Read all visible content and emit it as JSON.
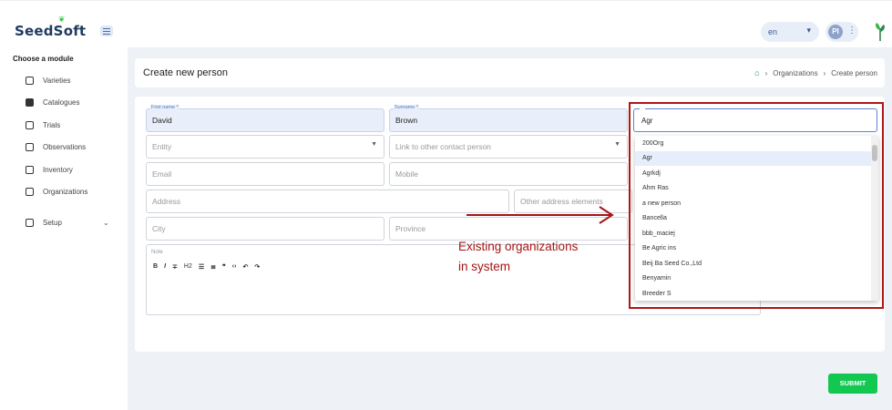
{
  "brand": {
    "name": "SeedSoft"
  },
  "header": {
    "lang": "en",
    "user_initials": "PI"
  },
  "sidebar": {
    "title": "Choose a module",
    "items": [
      {
        "label": "Varieties",
        "icon": "varieties-icon"
      },
      {
        "label": "Catalogues",
        "icon": "catalogues-icon"
      },
      {
        "label": "Trials",
        "icon": "trials-icon"
      },
      {
        "label": "Observations",
        "icon": "observations-icon"
      },
      {
        "label": "Inventory",
        "icon": "inventory-icon"
      },
      {
        "label": "Organizations",
        "icon": "organizations-icon"
      },
      {
        "label": "Setup",
        "icon": "setup-icon"
      }
    ]
  },
  "page": {
    "title": "Create new person",
    "breadcrumb": {
      "organizations": "Organizations",
      "current": "Create person"
    }
  },
  "form": {
    "first_name": {
      "label": "First name *",
      "value": "David"
    },
    "surname": {
      "label": "Surname *",
      "value": "Brown"
    },
    "entity": {
      "placeholder": "Entity"
    },
    "link_contact": {
      "placeholder": "Link to other contact person"
    },
    "email": {
      "placeholder": "Email"
    },
    "mobile": {
      "placeholder": "Mobile"
    },
    "address": {
      "placeholder": "Address"
    },
    "other_address": {
      "placeholder": "Other address elements"
    },
    "city": {
      "placeholder": "City"
    },
    "province": {
      "placeholder": "Province"
    },
    "note": {
      "label": "Note",
      "toolbar": [
        "B",
        "I",
        "S",
        "H2",
        "UL",
        "OL",
        "Quote",
        "Code",
        "Undo",
        "Redo"
      ]
    },
    "submit_label": "SUBMIT"
  },
  "supplier": {
    "value": "Agr",
    "options": [
      "200Org",
      "Agr",
      "Agrkdj",
      "Ahm Ras",
      "a new person",
      "Bancella",
      "bbb_maciej",
      "Be Agric ins",
      "Beij Ba Seed Co.,Ltd",
      "Benyamin",
      "Breeder S"
    ],
    "selected_index": 1
  },
  "annotation": {
    "line1": "Existing organizations",
    "line2": "in system"
  },
  "colors": {
    "accent": "#12c850",
    "annotation": "#a41515",
    "field_fill": "#e8effa"
  }
}
